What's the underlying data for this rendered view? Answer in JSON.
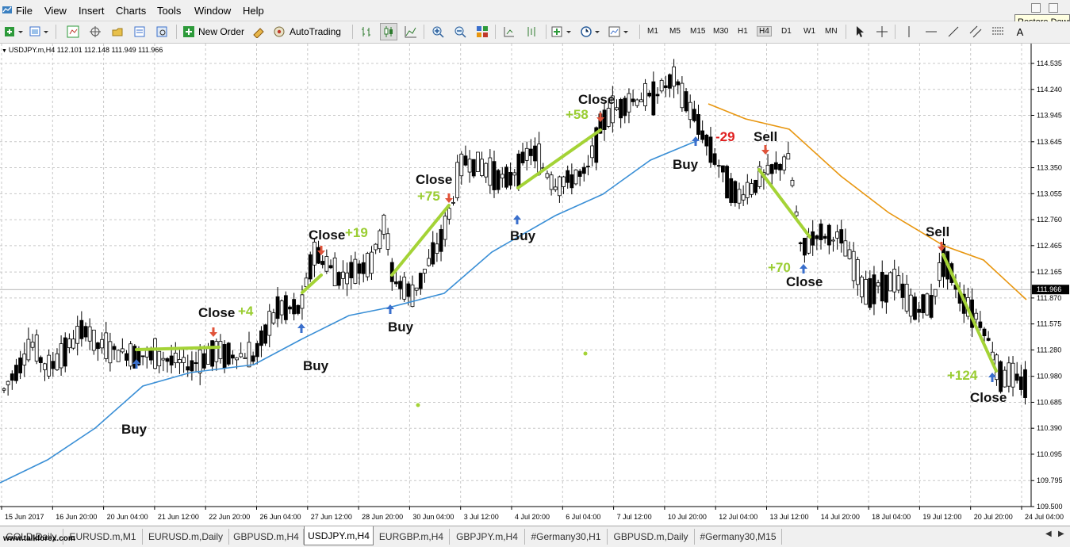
{
  "menubar": {
    "items": [
      "File",
      "View",
      "Insert",
      "Charts",
      "Tools",
      "Window",
      "Help"
    ],
    "tooltip": "Restore Down"
  },
  "toolbar": {
    "new_order": "New Order",
    "auto_trading": "AutoTrading",
    "timeframes": [
      "M1",
      "M5",
      "M15",
      "M30",
      "H1",
      "H4",
      "D1",
      "W1",
      "MN"
    ],
    "active_timeframe": "H4"
  },
  "chart": {
    "header": "USDJPY.m,H4  112.101 112.148 111.949 111.966",
    "current_price": "111.966",
    "price_ticks": [
      "114.535",
      "114.240",
      "113.945",
      "113.645",
      "113.350",
      "113.055",
      "112.760",
      "112.465",
      "112.165",
      "111.870",
      "111.575",
      "111.280",
      "110.980",
      "110.685",
      "110.390",
      "110.095",
      "109.795",
      "109.500"
    ],
    "date_ticks": [
      "15 Jun 2017",
      "16 Jun 20:00",
      "20 Jun 04:00",
      "21 Jun 12:00",
      "22 Jun 20:00",
      "26 Jun 04:00",
      "27 Jun 12:00",
      "28 Jun 20:00",
      "30 Jun 04:00",
      "3 Jul 12:00",
      "4 Jul 20:00",
      "6 Jul 04:00",
      "7 Jul 12:00",
      "10 Jul 20:00",
      "12 Jul 04:00",
      "13 Jul 12:00",
      "14 Jul 20:00",
      "18 Jul 04:00",
      "19 Jul 12:00",
      "20 Jul 20:00",
      "24 Jul 04:00"
    ],
    "annotations": {
      "buy1": "Buy",
      "close1": "Close",
      "pips1": "+4",
      "buy2": "Buy",
      "close2": "Close",
      "pips2": "+19",
      "buy3": "Buy",
      "close3": "Close",
      "pips3": "+75",
      "buy4": "Buy",
      "close4": "Close",
      "pips4": "+58",
      "buy5": "Buy",
      "pips5": "-29",
      "sell1": "Sell",
      "pips6": "+70",
      "close6": "Close",
      "sell2": "Sell",
      "pips7": "+124",
      "close7": "Close"
    },
    "colors": {
      "bullish_body": "#ffffff",
      "bearish_body": "#000000",
      "ma_fast": "#3a8fd6",
      "ma_slow": "#e8960f",
      "trade_line": "#a4d336",
      "buy_arrow": "#3a6fcc",
      "sell_arrow": "#e0533a",
      "profit": "#9acd32",
      "loss": "#e02020"
    }
  },
  "tabs": {
    "items": [
      "GOLD,Daily",
      "EURUSD.m,M1",
      "EURUSD.m,Daily",
      "GBPUSD.m,H4",
      "USDJPY.m,H4",
      "EURGBP.m,H4",
      "GBPJPY.m,H4",
      "#Germany30,H1",
      "GBPUSD.m,Daily",
      "#Germany30,M15"
    ],
    "active": "USDJPY.m,H4",
    "watermark": "www.talkforex.com"
  }
}
